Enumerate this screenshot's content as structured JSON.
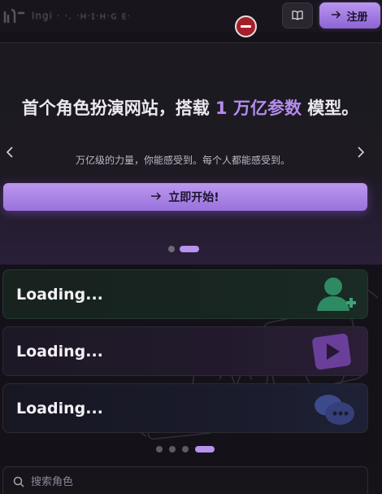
{
  "header": {
    "logo_text": "Ingi · ·. ·ʜ·ɪ·ʜ·ɢ ᴇ·",
    "book_icon": "book-open-icon",
    "signup_label": "注册",
    "remove_badge_icon": "minus-circle-icon"
  },
  "hero": {
    "title_part1": "首个角色扮演网站，搭载 ",
    "title_accent": "1 万亿参数",
    "title_part2": " 模型。",
    "subtitle": "万亿级的力量，你能感受到。每个人都能感受到。",
    "cta_label": "立即开始!",
    "prev_icon": "chevron-left-icon",
    "next_icon": "chevron-right-icon",
    "dots": 2,
    "active_dot": 1
  },
  "cards": [
    {
      "label": "Loading...",
      "icon": "user-add-icon",
      "accent": "#2e8a63"
    },
    {
      "label": "Loading...",
      "icon": "play-video-icon",
      "accent": "#6a3f9a"
    },
    {
      "label": "Loading...",
      "icon": "chat-bubbles-icon",
      "accent": "#3d4a8c"
    }
  ],
  "card_dots": {
    "count": 4,
    "active": 3
  },
  "search": {
    "placeholder": "搜索角色"
  }
}
